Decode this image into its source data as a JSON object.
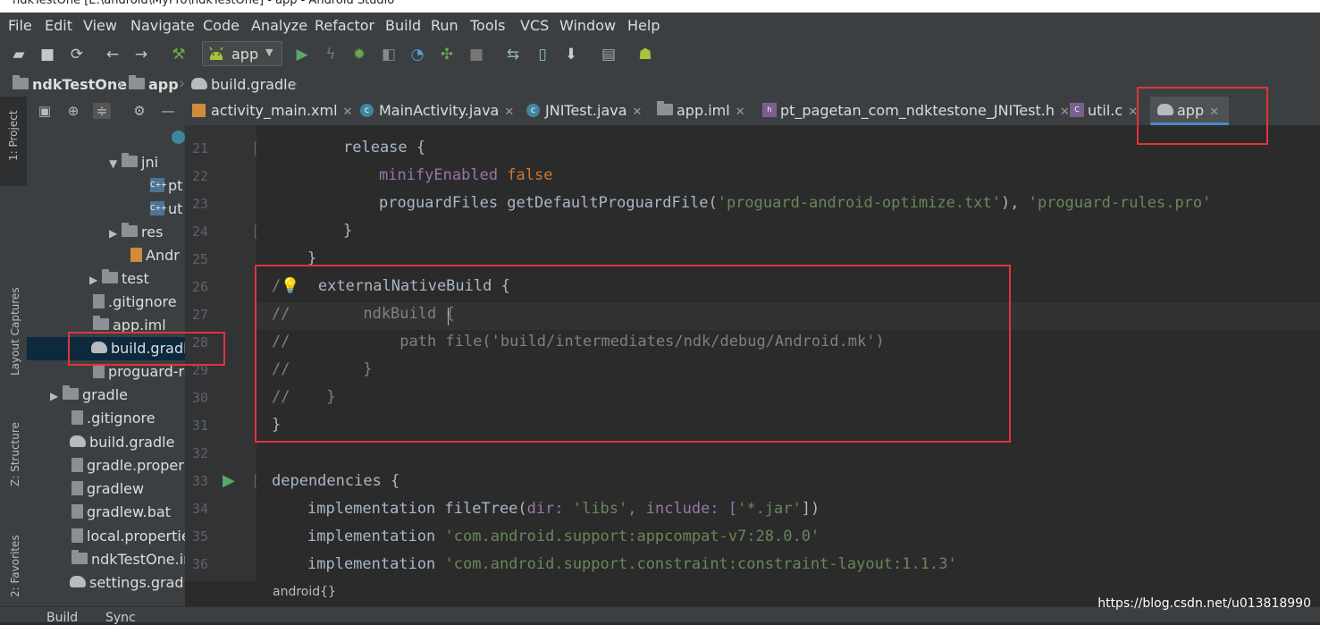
{
  "window": {
    "title": "ndkTestOne [E:\\android\\MyPro\\ndkTestOne] - app - Android Studio"
  },
  "menu": [
    "File",
    "Edit",
    "View",
    "Navigate",
    "Code",
    "Analyze",
    "Refactor",
    "Build",
    "Run",
    "Tools",
    "VCS",
    "Window",
    "Help"
  ],
  "toolbar": {
    "run_config": "app",
    "icons": [
      "open-icon",
      "save-icon",
      "sync-icon",
      "back-icon",
      "forward-icon",
      "build-hammer-icon",
      "run-icon",
      "apply-changes-icon",
      "debug-icon",
      "attach-debugger-icon",
      "profile-icon",
      "run-coverage-icon",
      "stop-icon",
      "gradle-sync-icon",
      "avd-manager-icon",
      "sdk-manager-icon",
      "project-structure-icon",
      "android-assistant-icon"
    ]
  },
  "breadcrumb": [
    "ndkTestOne",
    "app",
    "build.gradle"
  ],
  "left_strip": {
    "project": "1: Project",
    "layout_captures": "Layout Captures",
    "structure": "Z: Structure",
    "favorites": "2: Favorites"
  },
  "project_tree": [
    {
      "label": "jni",
      "type": "folder",
      "expanded": true
    },
    {
      "label": "pt",
      "type": "cfile"
    },
    {
      "label": "ut",
      "type": "cfile"
    },
    {
      "label": "res",
      "type": "folder",
      "expanded": false
    },
    {
      "label": "Andr",
      "type": "xml"
    },
    {
      "label": "test",
      "type": "folder",
      "expanded": false
    },
    {
      "label": ".gitignore",
      "type": "file"
    },
    {
      "label": "app.iml",
      "type": "file"
    },
    {
      "label": "build.gradle",
      "type": "gradle",
      "selected": true
    },
    {
      "label": "proguard-ru",
      "type": "file"
    },
    {
      "label": "gradle",
      "type": "folder",
      "expanded": false
    },
    {
      "label": ".gitignore",
      "type": "file"
    },
    {
      "label": "build.gradle",
      "type": "gradle"
    },
    {
      "label": "gradle.proper",
      "type": "file"
    },
    {
      "label": "gradlew",
      "type": "file"
    },
    {
      "label": "gradlew.bat",
      "type": "file"
    },
    {
      "label": "local.propertie",
      "type": "file"
    },
    {
      "label": "ndkTestOne.im",
      "type": "file"
    },
    {
      "label": "settings.gradle",
      "type": "gradle"
    }
  ],
  "tabs": [
    {
      "label": "activity_main.xml",
      "icon": "xml"
    },
    {
      "label": "MainActivity.java",
      "icon": "class"
    },
    {
      "label": "JNITest.java",
      "icon": "class"
    },
    {
      "label": "app.iml",
      "icon": "module"
    },
    {
      "label": "pt_pagetan_com_ndktestone_JNITest.h",
      "icon": "header"
    },
    {
      "label": "util.c",
      "icon": "cfile"
    },
    {
      "label": "app",
      "icon": "gradle",
      "active": true
    }
  ],
  "line_numbers": [
    "21",
    "22",
    "23",
    "24",
    "25",
    "26",
    "27",
    "28",
    "29",
    "30",
    "31",
    "32",
    "33",
    "34",
    "35",
    "36"
  ],
  "code_tokens": {
    "release": "release {",
    "minifyEnabled": "minifyEnabled",
    "false": "false",
    "proguardFiles": "proguardFiles getDefaultProguardFile(",
    "proguard_optimize": "'proguard-android-optimize.txt'",
    "comma": "), ",
    "proguard_rules": "'proguard-rules.pro'",
    "close_brace": "}",
    "ext_comment_prefix": "/",
    "externalNativeBuild": "  externalNativeBuild {",
    "l27": "//        ndkBuild {",
    "l28": "//            path file('build/intermediates/ndk/debug/Android.mk')",
    "l29": "//        }",
    "l30": "//    }",
    "l31": "}",
    "dependencies": "dependencies {",
    "implementation": "implementation",
    "fileTree": " fileTree(",
    "dir_key": "dir: ",
    "libs": "'libs'",
    "include_key": ", include: [",
    "jar": "'*.jar'",
    "fileTree_end": "])",
    "appcompat": " 'com.android.support:appcompat-v7:28.0.0'",
    "constraint": " 'com.android.support.constraint:constraint-layout:1.1.3'"
  },
  "status_path": "android{}",
  "bottom_tabs": [
    "Build",
    "Sync"
  ],
  "watermark": "https://blog.csdn.net/u013818990",
  "colors": {
    "keyword": "#cc7832",
    "string": "#6a8759",
    "property": "#9876aa",
    "comment": "#808080",
    "highlight_red": "#e0343a"
  }
}
